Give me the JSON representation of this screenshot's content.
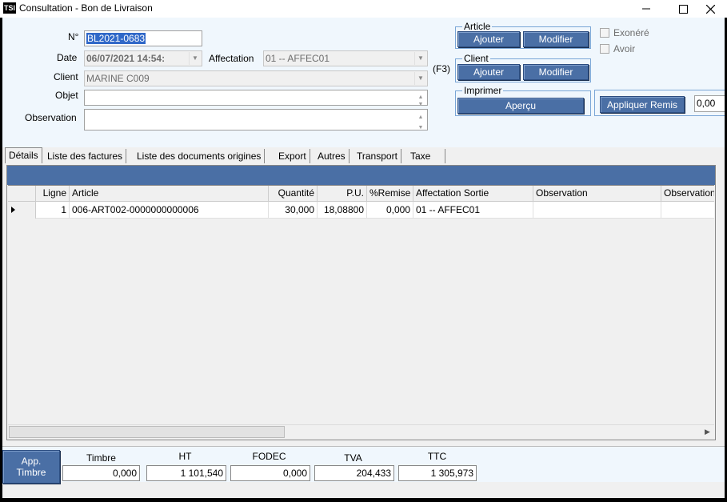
{
  "window": {
    "title": "Consultation - Bon de Livraison",
    "app_icon_text": "TSI",
    "minimize_icon": "minimize-icon",
    "maximize_icon": "maximize-icon",
    "close_icon": "close-icon"
  },
  "form": {
    "numero_label": "N°",
    "numero_value": "BL2021-0683",
    "date_label": "Date",
    "date_value": "06/07/2021 14:54:",
    "affectation_label": "Affectation",
    "affectation_value": "01 -- AFFEC01",
    "client_label": "Client",
    "client_value": "MARINE C009",
    "f3_label": "(F3)",
    "objet_label": "Objet",
    "objet_value": "",
    "observation_label": "Observation",
    "observation_value": ""
  },
  "article_group": {
    "title": "Article",
    "add_label": "Ajouter",
    "edit_label": "Modifier"
  },
  "client_group": {
    "title": "Client",
    "add_label": "Ajouter",
    "edit_label": "Modifier"
  },
  "print_group": {
    "title": "Imprimer",
    "preview_label": "Aperçu"
  },
  "options": {
    "exonere_label": "Exonéré",
    "exonere_checked": false,
    "avoir_label": "Avoir",
    "avoir_checked": false
  },
  "remise": {
    "button_label": "Appliquer Remis",
    "value": "0,00"
  },
  "tabs": [
    {
      "label": "Détails",
      "active": true
    },
    {
      "label": "Liste des factures",
      "active": false
    },
    {
      "label": "Liste des documents origines",
      "active": false
    },
    {
      "label": "Export",
      "active": false
    },
    {
      "label": "Autres",
      "active": false
    },
    {
      "label": "Transport",
      "active": false
    },
    {
      "label": "Taxe",
      "active": false
    }
  ],
  "grid": {
    "columns": [
      "Ligne",
      "Article",
      "Quantité",
      "P.U.",
      "%Remise",
      "Affectation Sortie",
      "Observation",
      "Observation"
    ],
    "rows": [
      {
        "ligne": "1",
        "article": "006-ART002-0000000000006",
        "quantite": "30,000",
        "pu": "18,08800",
        "remise": "0,000",
        "affectation": "01 -- AFFEC01",
        "observation": "",
        "observation2": ""
      }
    ]
  },
  "totals": {
    "app_timbre_label": "App.\nTimbre",
    "timbre_label": "Timbre",
    "timbre_value": "0,000",
    "ht_label": "HT",
    "ht_value": "1 101,540",
    "fodec_label": "FODEC",
    "fodec_value": "0,000",
    "tva_label": "TVA",
    "tva_value": "204,433",
    "ttc_label": "TTC",
    "ttc_value": "1 305,973"
  },
  "colors": {
    "accent": "#4a6fa5",
    "form_bg": "#f0f7fd",
    "selection": "#3068c8"
  }
}
